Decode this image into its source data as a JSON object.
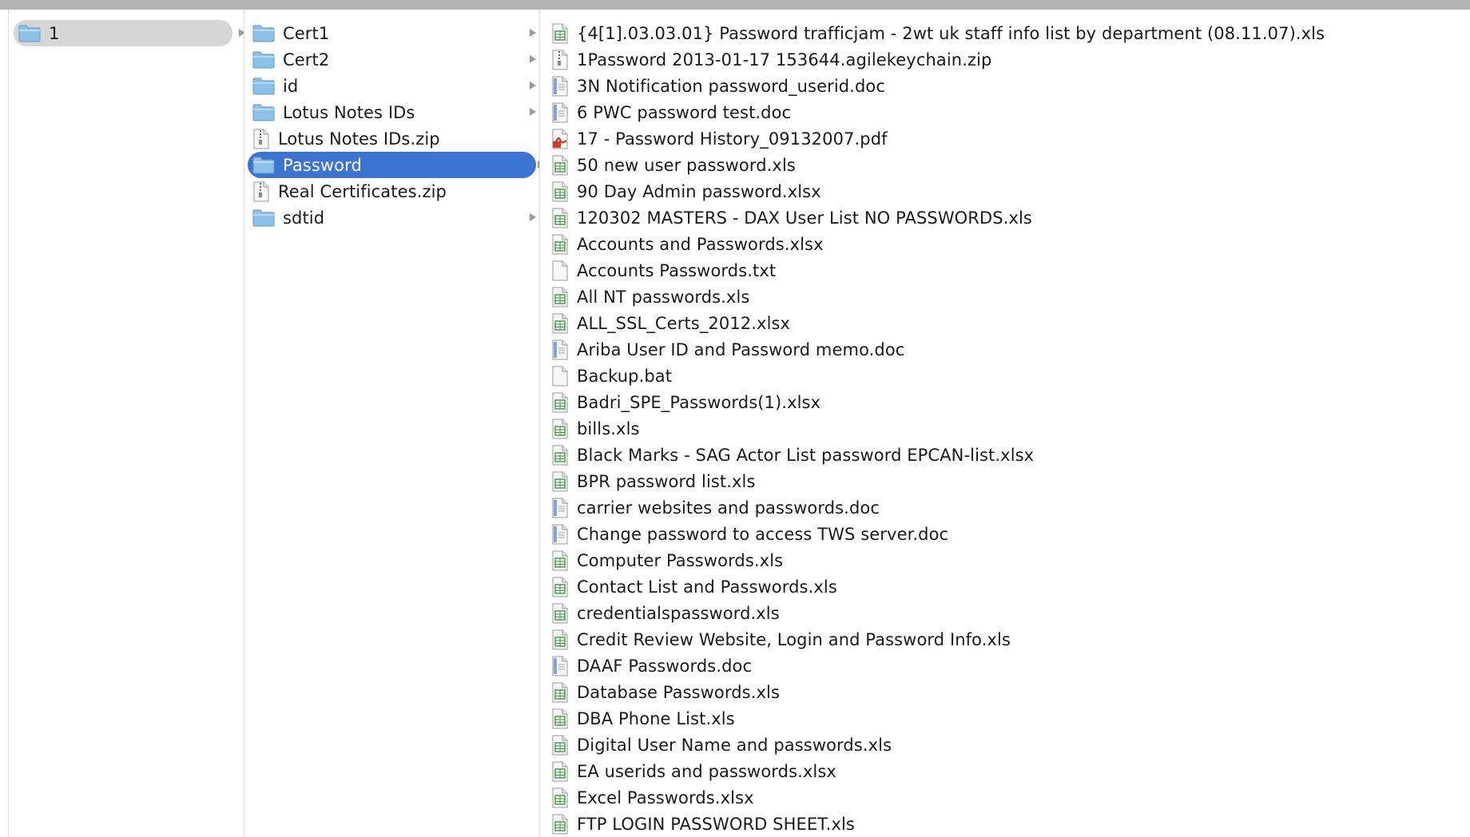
{
  "column1": {
    "items": [
      {
        "label": "1",
        "icon": "folder-icon",
        "kind": "folder",
        "selected": true
      }
    ]
  },
  "column2": {
    "items": [
      {
        "label": "Cert1",
        "icon": "folder-icon",
        "kind": "folder"
      },
      {
        "label": "Cert2",
        "icon": "folder-icon",
        "kind": "folder"
      },
      {
        "label": "id",
        "icon": "folder-icon",
        "kind": "folder"
      },
      {
        "label": "Lotus Notes IDs",
        "icon": "folder-icon",
        "kind": "folder"
      },
      {
        "label": "Lotus Notes IDs.zip",
        "icon": "zip-file-icon",
        "kind": "zip"
      },
      {
        "label": "Password",
        "icon": "folder-icon",
        "kind": "folder",
        "selected": true
      },
      {
        "label": "Real Certificates.zip",
        "icon": "zip-file-icon",
        "kind": "zip"
      },
      {
        "label": "sdtid",
        "icon": "folder-icon",
        "kind": "folder"
      }
    ]
  },
  "column3": {
    "items": [
      {
        "label": "{4[1].03.03.01} Password trafficjam - 2wt uk staff info list by department (08.11.07).xls",
        "icon": "spreadsheet-file-icon",
        "kind": "xls"
      },
      {
        "label": "1Password 2013-01-17 153644.agilekeychain.zip",
        "icon": "zip-file-icon",
        "kind": "zip"
      },
      {
        "label": "3N Notification password_userid.doc",
        "icon": "document-file-icon",
        "kind": "doc"
      },
      {
        "label": "6 PWC password test.doc",
        "icon": "document-file-icon",
        "kind": "doc"
      },
      {
        "label": "17 - Password History_09132007.pdf",
        "icon": "pdf-file-icon",
        "kind": "pdf"
      },
      {
        "label": "50 new user password.xls",
        "icon": "spreadsheet-file-icon",
        "kind": "xls"
      },
      {
        "label": "90 Day Admin password.xlsx",
        "icon": "spreadsheet-file-icon",
        "kind": "xlsx"
      },
      {
        "label": "120302 MASTERS - DAX User List NO PASSWORDS.xls",
        "icon": "spreadsheet-file-icon",
        "kind": "xls"
      },
      {
        "label": "Accounts and Passwords.xlsx",
        "icon": "spreadsheet-file-icon",
        "kind": "xlsx"
      },
      {
        "label": "Accounts Passwords.txt",
        "icon": "text-file-icon",
        "kind": "txt"
      },
      {
        "label": "All NT passwords.xls",
        "icon": "spreadsheet-file-icon",
        "kind": "xls"
      },
      {
        "label": "ALL_SSL_Certs_2012.xlsx",
        "icon": "spreadsheet-file-icon",
        "kind": "xlsx"
      },
      {
        "label": "Ariba User ID and Password memo.doc",
        "icon": "document-file-icon",
        "kind": "doc"
      },
      {
        "label": "Backup.bat",
        "icon": "text-file-icon",
        "kind": "txt"
      },
      {
        "label": "Badri_SPE_Passwords(1).xlsx",
        "icon": "spreadsheet-file-icon",
        "kind": "xlsx"
      },
      {
        "label": "bills.xls",
        "icon": "spreadsheet-file-icon",
        "kind": "xls"
      },
      {
        "label": "Black Marks - SAG Actor List password EPCAN-list.xlsx",
        "icon": "spreadsheet-file-icon",
        "kind": "xlsx"
      },
      {
        "label": "BPR password list.xls",
        "icon": "spreadsheet-file-icon",
        "kind": "xls"
      },
      {
        "label": "carrier websites and passwords.doc",
        "icon": "document-file-icon",
        "kind": "doc"
      },
      {
        "label": "Change password to access TWS server.doc",
        "icon": "document-file-icon",
        "kind": "doc"
      },
      {
        "label": "Computer Passwords.xls",
        "icon": "spreadsheet-file-icon",
        "kind": "xls"
      },
      {
        "label": "Contact List and Passwords.xls",
        "icon": "spreadsheet-file-icon",
        "kind": "xls"
      },
      {
        "label": "credentialspassword.xls",
        "icon": "spreadsheet-file-icon",
        "kind": "xls"
      },
      {
        "label": "Credit Review Website, Login and Password Info.xls",
        "icon": "spreadsheet-file-icon",
        "kind": "xls"
      },
      {
        "label": "DAAF Passwords.doc",
        "icon": "document-file-icon",
        "kind": "doc"
      },
      {
        "label": "Database Passwords.xls",
        "icon": "spreadsheet-file-icon",
        "kind": "xls"
      },
      {
        "label": "DBA Phone List.xls",
        "icon": "spreadsheet-file-icon",
        "kind": "xls"
      },
      {
        "label": "Digital User Name and passwords.xls",
        "icon": "spreadsheet-file-icon",
        "kind": "xls"
      },
      {
        "label": "EA userids and passwords.xlsx",
        "icon": "spreadsheet-file-icon",
        "kind": "xlsx"
      },
      {
        "label": "Excel Passwords.xlsx",
        "icon": "spreadsheet-file-icon",
        "kind": "xlsx"
      },
      {
        "label": "FTP LOGIN PASSWORD SHEET.xls",
        "icon": "spreadsheet-file-icon",
        "kind": "xls"
      }
    ]
  },
  "colors": {
    "selection_active": "#3c74d2",
    "selection_inactive": "#d6d6d6",
    "folder": "#8cc1e8",
    "spreadsheet_accent": "#3c9a3c",
    "document_accent": "#5a8ad2",
    "pdf_accent": "#d23a2a"
  }
}
